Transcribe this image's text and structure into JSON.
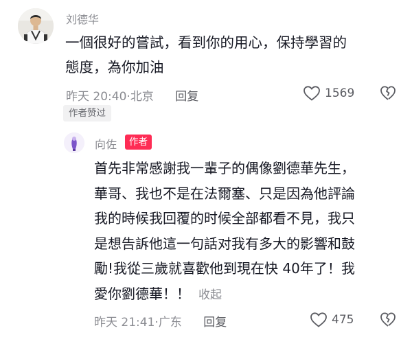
{
  "top_comment": {
    "username": "刘德华",
    "text_lines": [
      "一個很好的嘗試，看到你的用心，保持學習的",
      "態度，為你加油"
    ],
    "time": "昨天 20:40",
    "location": "北京",
    "reply_label": "回复",
    "likes": "1569",
    "author_liked_badge": "作者赞过"
  },
  "reply": {
    "username": "向佐",
    "author_tag": "作者",
    "text_lines": [
      "首先非常感謝我一輩子的偶像劉德華先生，",
      "華哥、我也不是在法爾塞、只是因為他評論",
      "我的時候我回覆的时候全部都看不見，我只",
      "是想告訴他這一句話对我有多大的影響和鼓",
      "勵!我從三歲就喜歡他到現在快 40年了！我",
      "愛你劉德華！！"
    ],
    "collapse_label": "收起",
    "time": "昨天 21:41",
    "location": "广东",
    "reply_label": "回复",
    "likes": "475"
  },
  "colors": {
    "secondary_text": "#8a8b91",
    "primary_text": "#161823",
    "author_tag_bg": "#fe2c55",
    "badge_bg": "#f1f1f2"
  },
  "icons": [
    "heart-outline-icon",
    "broken-heart-icon"
  ]
}
